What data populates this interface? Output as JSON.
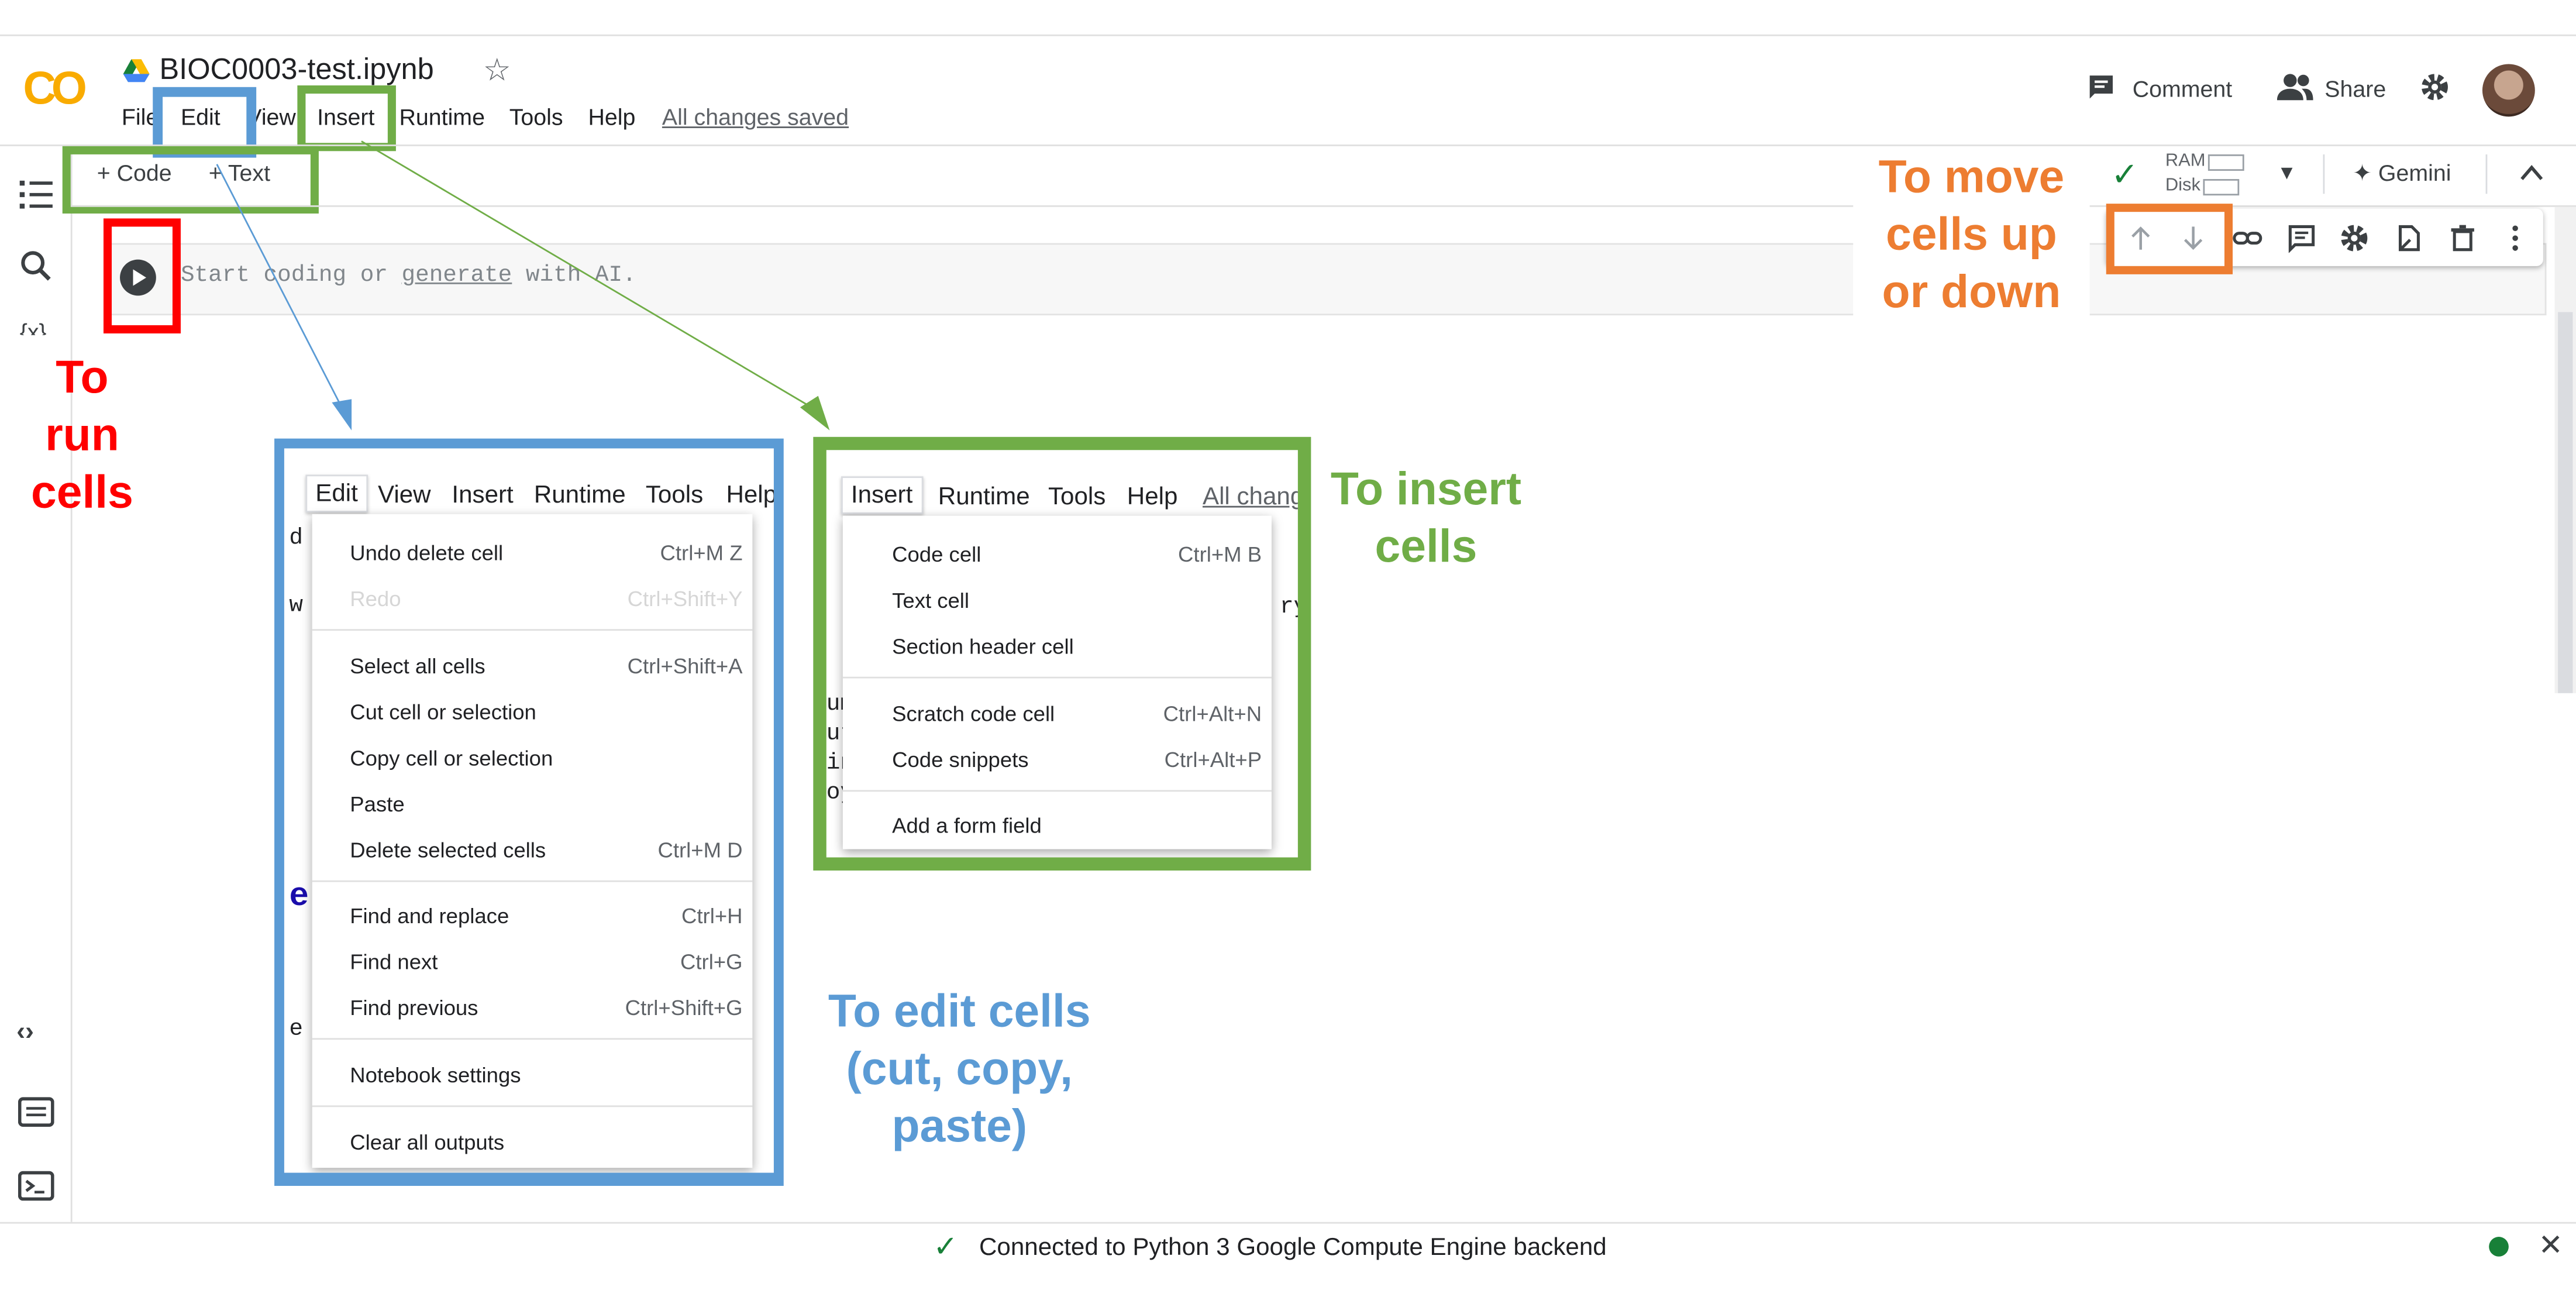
{
  "app": {
    "logo": "CO",
    "notebook_title": "BIOC0003-test.ipynb",
    "menu": [
      "File",
      "Edit",
      "View",
      "Insert",
      "Runtime",
      "Tools",
      "Help"
    ],
    "saved_status": "All changes saved",
    "comment_label": "Comment",
    "share_label": "Share",
    "toolbar": {
      "code_label": "+ Code",
      "text_label": "+ Text"
    },
    "resources": {
      "ram_label": "RAM",
      "disk_label": "Disk",
      "gemini_label": "✦ Gemini"
    },
    "cell": {
      "prompt_before": "Start coding or ",
      "prompt_link": "generate",
      "prompt_after": " with AI."
    },
    "status_bar": {
      "message": "Connected to Python 3 Google Compute Engine backend"
    }
  },
  "annotations": {
    "run_cells": "To\nrun\ncells",
    "move_cells": "To move\ncells up\nor down",
    "insert_cells": "To insert\ncells",
    "edit_cells": "To edit cells\n(cut, copy,\npaste)"
  },
  "edit_panel": {
    "menubar": [
      "Edit",
      "View",
      "Insert",
      "Runtime",
      "Tools",
      "Help"
    ],
    "items": [
      {
        "label": "Undo delete cell",
        "shortcut": "Ctrl+M Z",
        "disabled": false
      },
      {
        "label": "Redo",
        "shortcut": "Ctrl+Shift+Y",
        "disabled": true
      },
      {
        "label": "Select all cells",
        "shortcut": "Ctrl+Shift+A",
        "disabled": false
      },
      {
        "label": "Cut cell or selection",
        "shortcut": "",
        "disabled": false
      },
      {
        "label": "Copy cell or selection",
        "shortcut": "",
        "disabled": false
      },
      {
        "label": "Paste",
        "shortcut": "",
        "disabled": false
      },
      {
        "label": "Delete selected cells",
        "shortcut": "Ctrl+M D",
        "disabled": false
      },
      {
        "label": "Find and replace",
        "shortcut": "Ctrl+H",
        "disabled": false
      },
      {
        "label": "Find next",
        "shortcut": "Ctrl+G",
        "disabled": false
      },
      {
        "label": "Find previous",
        "shortcut": "Ctrl+Shift+G",
        "disabled": false
      },
      {
        "label": "Notebook settings",
        "shortcut": "",
        "disabled": false
      },
      {
        "label": "Clear all outputs",
        "shortcut": "",
        "disabled": false
      }
    ]
  },
  "insert_panel": {
    "menubar": [
      "Insert",
      "Runtime",
      "Tools",
      "Help",
      "All chang"
    ],
    "items": [
      {
        "label": "Code cell",
        "shortcut": "Ctrl+M B"
      },
      {
        "label": "Text cell",
        "shortcut": ""
      },
      {
        "label": "Section header cell",
        "shortcut": ""
      },
      {
        "label": "Scratch code cell",
        "shortcut": "Ctrl+Alt+N"
      },
      {
        "label": "Code snippets",
        "shortcut": "Ctrl+Alt+P"
      },
      {
        "label": "Add a form field",
        "shortcut": ""
      }
    ]
  },
  "colors": {
    "blue": "#5b9bd5",
    "green": "#70ad47",
    "red": "#ff0000",
    "orange": "#ed7d31"
  }
}
